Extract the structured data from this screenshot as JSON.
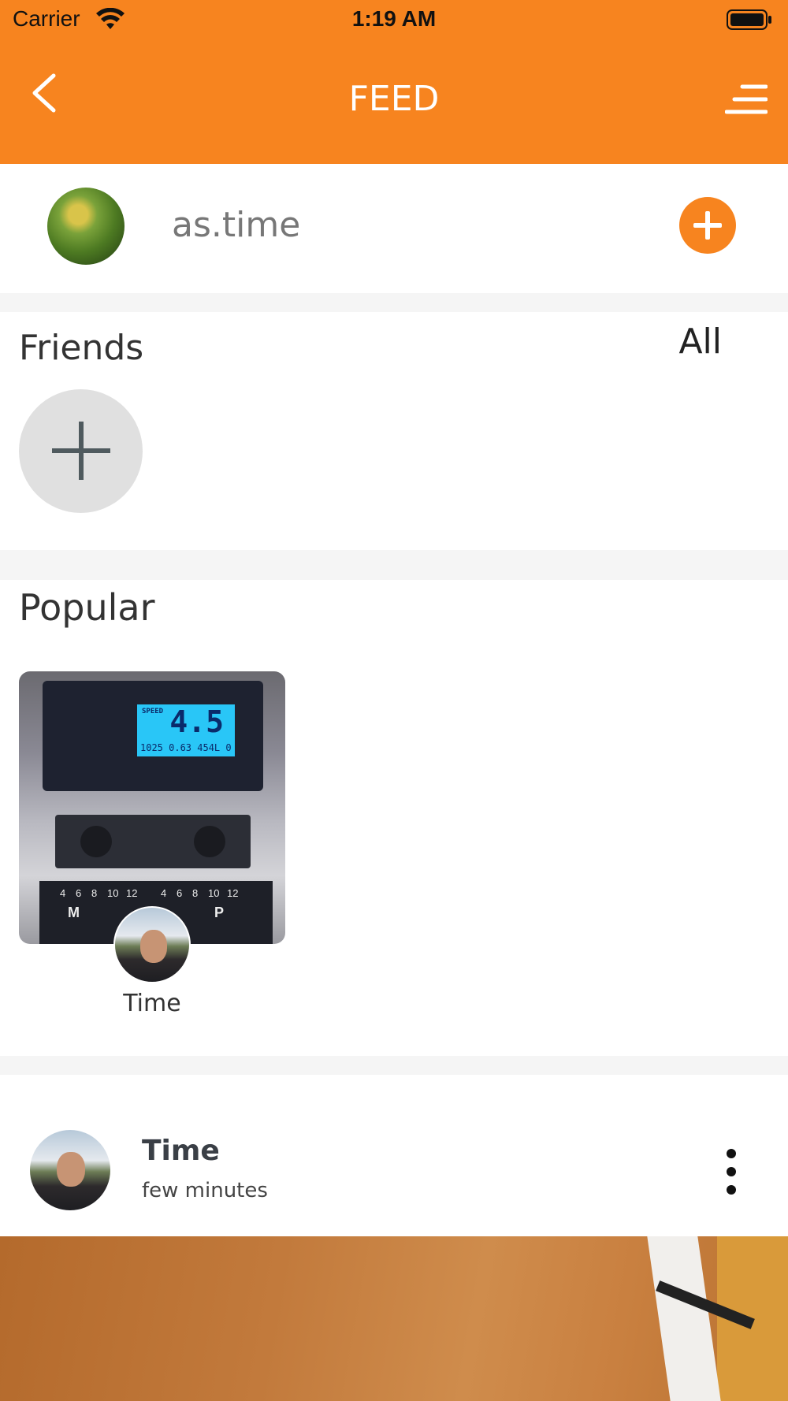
{
  "status_bar": {
    "carrier": "Carrier",
    "time": "1:19 AM"
  },
  "nav": {
    "title": "FEED",
    "back_icon": "chevron-left-icon",
    "menu_icon": "menu-icon"
  },
  "profile": {
    "name": "as.time",
    "add_icon": "plus-icon"
  },
  "friends": {
    "title": "Friends",
    "all_label": "All",
    "add_icon": "plus-icon"
  },
  "popular": {
    "title": "Popular",
    "items": [
      {
        "author": "Time",
        "lcd_label": "SPEED",
        "lcd_value": "4.5",
        "lcd_sub": "1025 0.63 454L 0",
        "keys": [
          "4",
          "6",
          "8",
          "10",
          "12",
          "4",
          "6",
          "8",
          "10",
          "12",
          "M",
          "P"
        ]
      }
    ]
  },
  "post": {
    "author": "Time",
    "time": "few minutes",
    "more_icon": "more-vertical-icon"
  },
  "colors": {
    "accent": "#f7841f",
    "background": "#f5f5f5"
  }
}
